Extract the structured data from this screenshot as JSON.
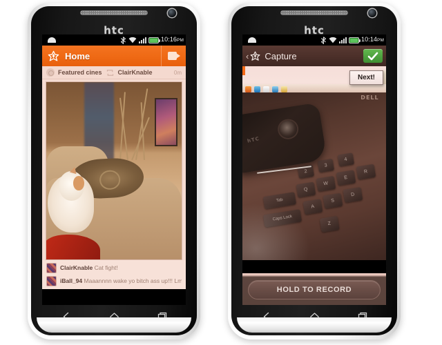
{
  "phones": [
    {
      "id": "left",
      "brand_logo": "htc",
      "status_bar": {
        "time": "10:16",
        "ampm": "PM",
        "icons": [
          "bluetooth-icon",
          "wifi-icon",
          "signal-bars-icon",
          "battery-icon"
        ]
      },
      "app_bar": {
        "logo_icon": "app-pinwheel-logo-icon",
        "title": "Home",
        "action_icon": "video-camera-icon"
      },
      "sub_header": {
        "source_icon": "featured-circle-icon",
        "source_label": "Featured cines",
        "repost_icon": "repost-icon",
        "user": "ClairKnable",
        "age": "0m"
      },
      "media": {
        "alt": "white and orange cat lying on a beige couch next to a patterned pillow"
      },
      "comments": [
        {
          "avatar": "user-avatar",
          "user": "ClairKnable",
          "text": "Cat fight!"
        },
        {
          "avatar": "user-avatar",
          "user": "iBall_94",
          "text": "Maaannnn wake yo bitch ass up!!! Lmao"
        }
      ],
      "nav": [
        {
          "name": "back-button",
          "icon": "chevron-left-icon"
        },
        {
          "name": "home-button",
          "icon": "home-icon"
        },
        {
          "name": "recent-apps-button",
          "icon": "recent-apps-icon"
        }
      ]
    },
    {
      "id": "right",
      "brand_logo": "htc",
      "status_bar": {
        "time": "10:14",
        "ampm": "PM",
        "icons": [
          "bluetooth-icon",
          "wifi-icon",
          "signal-bars-icon",
          "battery-icon"
        ]
      },
      "app_bar": {
        "back_chevron": "‹",
        "logo_icon": "app-pinwheel-logo-icon",
        "title": "Capture",
        "confirm_icon": "checkmark-icon"
      },
      "viewfinder": {
        "alt": "camera view of an HTC phone resting on a dark Dell laptop keyboard",
        "laptop_brand": "DELL",
        "phone_brand": "hTC",
        "keys": [
          "Tab",
          "Caps Lock",
          "Q",
          "W",
          "E",
          "R",
          "A",
          "S",
          "D",
          "Z",
          "2",
          "3",
          "4"
        ]
      },
      "tooltip": {
        "label": "Next!"
      },
      "record_button": {
        "label": "HOLD TO RECORD"
      },
      "nav": [
        {
          "name": "back-button",
          "icon": "chevron-left-icon"
        },
        {
          "name": "home-button",
          "icon": "home-icon"
        },
        {
          "name": "recent-apps-button",
          "icon": "recent-apps-icon"
        }
      ]
    }
  ],
  "colors": {
    "accent_orange": "#ef6a15",
    "capture_brown": "#4b2f29",
    "confirm_green": "#4da23c",
    "comment_bg": "#f7e1d8",
    "subbar_bg": "#f4d9cf"
  }
}
